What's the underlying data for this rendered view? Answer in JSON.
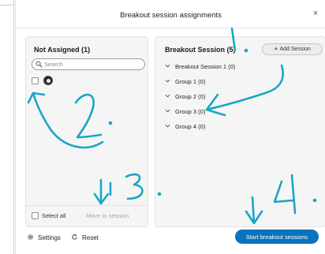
{
  "dialog": {
    "title": "Breakout session assignments",
    "close_symbol": "×"
  },
  "not_assigned": {
    "heading": "Not Assigned (1)",
    "search_placeholder": "Search",
    "select_all_label": "Select all",
    "move_label": "Move to session"
  },
  "breakout": {
    "heading": "Breakout Session  (5)",
    "add_session_label": "Add Session",
    "items": [
      {
        "label": "Breakout Session 1 (0)"
      },
      {
        "label": "Group 1 (0)"
      },
      {
        "label": "Group 2 (0)"
      },
      {
        "label": "Group 3 (0)"
      },
      {
        "label": "Group 4 (0)"
      }
    ]
  },
  "footer": {
    "settings_label": "Settings",
    "reset_label": "Reset",
    "start_label": "Start breakout sessions"
  },
  "annotations": {
    "marks": [
      "1.",
      "2.",
      "3.",
      "4."
    ],
    "ink_color": "#1aa6c6"
  },
  "colors": {
    "primary": "#0a73bd",
    "panel_bg": "#f5f5f5"
  },
  "icons": [
    "close-icon",
    "search-icon",
    "avatar",
    "plus-icon",
    "chevron-down-icon",
    "gear-icon",
    "reset-icon"
  ]
}
